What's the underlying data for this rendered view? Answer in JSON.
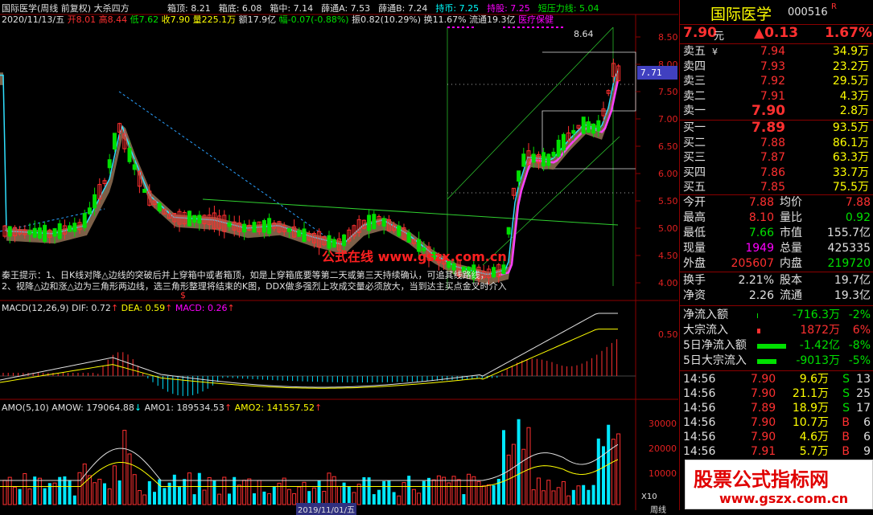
{
  "header": {
    "date": "2020/11/13/五",
    "title": "国际医学(周线 前复权)",
    "formula": "大杀四方",
    "open": "开8.01",
    "high": "高8.44",
    "low": "低7.62",
    "close": "收7.90",
    "volume": "量225.1万",
    "amount": "额17.9亿",
    "change": "幅-0.07(-0.88%)",
    "amplitude": "振0.82(10.29%)",
    "turnover": "换11.67%",
    "float_cap": "流通19.3亿",
    "sector": "医疗保健",
    "indicators": [
      {
        "label": "箱顶: 8.21",
        "color": "#e0e0e0"
      },
      {
        "label": "箱底: 6.08",
        "color": "#e0e0e0"
      },
      {
        "label": "箱中: 7.14",
        "color": "#e0e0e0"
      },
      {
        "label": "薛通A: 7.53",
        "color": "#e0e0e0"
      },
      {
        "label": "薛通B: 7.24",
        "color": "#e0e0e0"
      },
      {
        "label": "持币: 7.25",
        "color": "#00ffff"
      },
      {
        "label": "持股: 7.25",
        "color": "#ff00ff"
      },
      {
        "label": "短压力线: 5.04",
        "color": "#00e000"
      }
    ]
  },
  "main_chart": {
    "y_ticks": [
      "8.50",
      "8.00",
      "7.50",
      "7.00",
      "6.50",
      "6.00",
      "5.50",
      "5.00",
      "4.50",
      "4.00"
    ],
    "current_price_tag": "7.71",
    "peak_label": "8.64",
    "tip_line1": "秦王提示：1、日K线对降△边线的突破后并上穿箱中或者箱顶，如是上穿箱底要等第二天或第三天持续确认，可追其线路线，",
    "tip_line2": "2、视降△边和涨△边为三角形两边线，选三角形整理将结束的K图，DDX做多强烈上攻成交量必须放大，当到达主买点金叉时介入",
    "watermark": "公式在线 www.gszx.com.cn",
    "date_marker": "$"
  },
  "macd": {
    "label": "MACD(12,26,9)",
    "dif": "DIF: 0.72",
    "dea": "DEA: 0.59",
    "macd": "MACD: 0.26",
    "y_ticks": [
      "0.50"
    ]
  },
  "amo": {
    "label": "AMO(5,10)",
    "amow": "AMOW: 179064.88",
    "amo1": "AMO1: 189534.53",
    "amo2": "AMO2: 141557.52",
    "y_ticks": [
      "30000",
      "20000",
      "10000"
    ],
    "unit": "X10",
    "bottom_date": "2019/11/01/五",
    "weekly_label": "周线"
  },
  "quote": {
    "name": "国际医学",
    "code": "000516",
    "badge": "R",
    "price": "7.90",
    "price_unit": "元",
    "change": "▲0.13",
    "change_pct": "1.67%",
    "asks": [
      {
        "label": "卖五",
        "extra": "¥",
        "price": "7.94",
        "vol": "34.9万"
      },
      {
        "label": "卖四",
        "extra": "",
        "price": "7.93",
        "vol": "23.2万"
      },
      {
        "label": "卖三",
        "extra": "",
        "price": "7.92",
        "vol": "29.5万"
      },
      {
        "label": "卖二",
        "extra": "",
        "price": "7.91",
        "vol": "4.3万"
      },
      {
        "label": "卖一",
        "extra": "",
        "price": "7.90",
        "vol": "2.8万"
      }
    ],
    "bids": [
      {
        "label": "买一",
        "price": "7.89",
        "vol": "93.5万"
      },
      {
        "label": "买二",
        "price": "7.88",
        "vol": "86.1万"
      },
      {
        "label": "买三",
        "price": "7.87",
        "vol": "63.3万"
      },
      {
        "label": "买四",
        "price": "7.86",
        "vol": "33.7万"
      },
      {
        "label": "买五",
        "price": "7.85",
        "vol": "75.5万"
      }
    ],
    "stats": [
      {
        "l1": "今开",
        "v1": "7.88",
        "c1": "#ff3030",
        "l2": "均价",
        "v2": "7.88",
        "c2": "#ff3030"
      },
      {
        "l1": "最高",
        "v1": "8.10",
        "c1": "#ff3030",
        "l2": "量比",
        "v2": "0.92",
        "c2": "#00e000"
      },
      {
        "l1": "最低",
        "v1": "7.66",
        "c1": "#00e000",
        "l2": "市值",
        "v2": "155.7亿",
        "c2": "#e0e0e0"
      },
      {
        "l1": "现量",
        "v1": "1949",
        "c1": "#ff00ff",
        "l2": "总量",
        "v2": "425335",
        "c2": "#e0e0e0"
      },
      {
        "l1": "外盘",
        "v1": "205607",
        "c1": "#ff3030",
        "l2": "内盘",
        "v2": "219720",
        "c2": "#00e000"
      }
    ],
    "stats2": [
      {
        "l1": "换手",
        "v1": "2.21%",
        "l2": "股本",
        "v2": "19.7亿"
      },
      {
        "l1": "净资",
        "v1": "2.26",
        "l2": "流通",
        "v2": "19.3亿"
      }
    ],
    "flows": [
      {
        "label": "净流入额",
        "value": "-716.3万",
        "pct": "-2%",
        "vcolor": "#00e000",
        "bar": 1,
        "barcolor": "#00e000"
      },
      {
        "label": "大宗流入",
        "value": "1872万",
        "pct": "6%",
        "vcolor": "#ff3030",
        "bar": 4,
        "barcolor": "#ff3030"
      },
      {
        "label": "5日净流入额",
        "value": "-1.42亿",
        "pct": "-8%",
        "vcolor": "#00e000",
        "bar": 36,
        "barcolor": "#00e000"
      },
      {
        "label": "5日大宗流入",
        "value": "-9013万",
        "pct": "-5%",
        "vcolor": "#00e000",
        "bar": 24,
        "barcolor": "#00e000"
      }
    ],
    "ticks": [
      {
        "time": "14:56",
        "price": "7.90",
        "vol": "9.6万",
        "side": "S",
        "n": "13"
      },
      {
        "time": "14:56",
        "price": "7.90",
        "vol": "21.1万",
        "side": "S",
        "n": "25"
      },
      {
        "time": "14:56",
        "price": "7.89",
        "vol": "18.9万",
        "side": "S",
        "n": "17"
      },
      {
        "time": "14:56",
        "price": "7.90",
        "vol": "10.7万",
        "side": "B",
        "n": "6"
      },
      {
        "time": "14:56",
        "price": "7.90",
        "vol": "4.6万",
        "side": "B",
        "n": "6"
      },
      {
        "time": "14:56",
        "price": "7.91",
        "vol": "5.7万",
        "side": "B",
        "n": "9"
      }
    ],
    "banner_title": "股票公式指标网",
    "banner_url": "www.gszx.com.cn"
  }
}
